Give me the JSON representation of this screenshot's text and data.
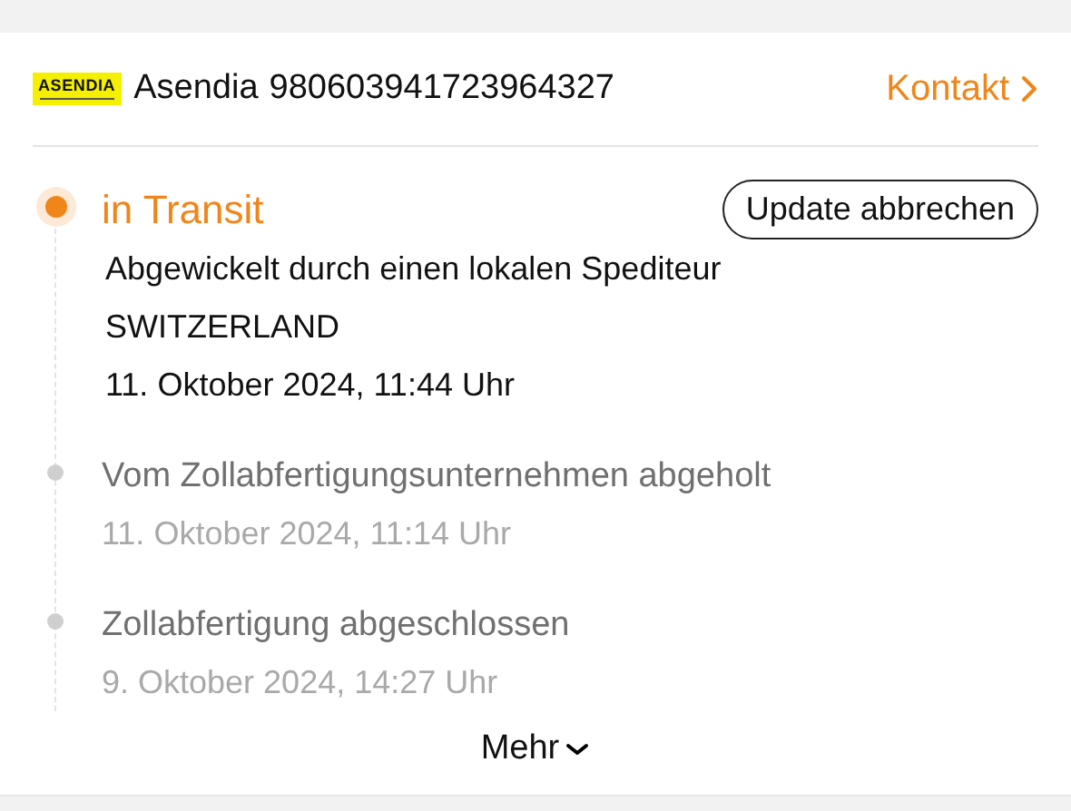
{
  "carrier": {
    "logo_text": "ASENDIA",
    "name": "Asendia",
    "tracking_number": "980603941723964327"
  },
  "contact_link": "Kontakt",
  "cancel_button": "Update abbrechen",
  "events": [
    {
      "title": "in Transit",
      "current": true,
      "details": [
        "Abgewickelt durch einen lokalen Spediteur",
        "SWITZERLAND"
      ],
      "time": "11. Oktober 2024, 11:44 Uhr"
    },
    {
      "title": "Vom Zollabfertigungsunternehmen abgeholt",
      "current": false,
      "time": "11. Oktober 2024, 11:14 Uhr"
    },
    {
      "title": "Zollabfertigung abgeschlossen",
      "current": false,
      "time": "9. Oktober 2024, 14:27 Uhr"
    }
  ],
  "more_button": "Mehr"
}
